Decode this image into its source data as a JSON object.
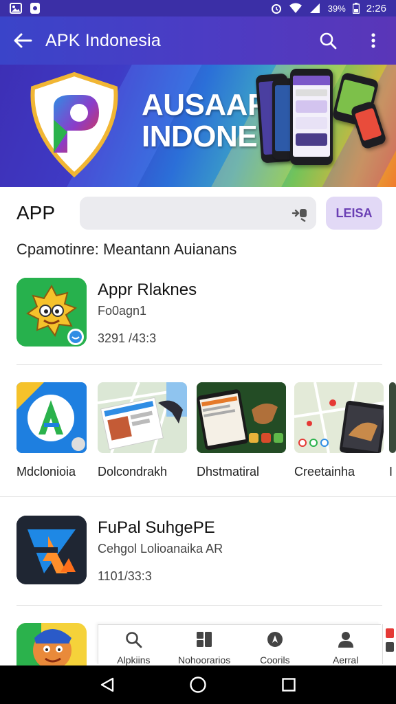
{
  "status_bar": {
    "battery": "39%",
    "time": "2:26"
  },
  "app_bar": {
    "title": "APK Indonesia",
    "back_icon": "back-arrow-icon",
    "search_icon": "search-icon",
    "menu_icon": "overflow-menu-icon"
  },
  "banner": {
    "line1": "AUSAAP",
    "line2": "INDONE",
    "accent_colors": [
      "#3d2fb5",
      "#2b6fd8",
      "#72c35a",
      "#f07b2c"
    ],
    "active_dot_color": "#f07b2c",
    "inactive_dot_color": "#6ac06a"
  },
  "search_row": {
    "label": "APP",
    "placeholder": "",
    "action_label": "LEISA"
  },
  "category_line": "Cpamotinre:  Meantann Auianans",
  "featured_apps": [
    {
      "name": "Appr Rlaknes",
      "subtitle": "Fo0agn1",
      "meta": "3291 /43:3",
      "icon_color": "#24b04b"
    },
    {
      "name": "FuPal SuhgePE",
      "subtitle": "Cehgol Lolioanaika AR",
      "meta": "1101/33:3",
      "icon_color": "#222a38"
    }
  ],
  "carousel": [
    {
      "label": "Mdclonioia",
      "icon_name": "app-logo-a-icon"
    },
    {
      "label": "Dolcondrakh",
      "icon_name": "map-screenshot-thumbnail"
    },
    {
      "label": "Dhstmatiral",
      "icon_name": "game-screenshot-thumbnail"
    },
    {
      "label": "Creetainha",
      "icon_name": "map-pet-thumbnail"
    },
    {
      "label": "I",
      "icon_name": "partial-thumbnail"
    }
  ],
  "bottom_nav": [
    {
      "label": "Alpkiins",
      "icon": "search-icon"
    },
    {
      "label": "Nohoorarios",
      "icon": "grid-apps-icon"
    },
    {
      "label": "Coorils",
      "icon": "compass-icon"
    },
    {
      "label": "Aerral",
      "icon": "person-icon"
    }
  ],
  "system_nav": {
    "back": "back-triangle-icon",
    "home": "home-circle-icon",
    "recents": "recents-square-icon"
  }
}
